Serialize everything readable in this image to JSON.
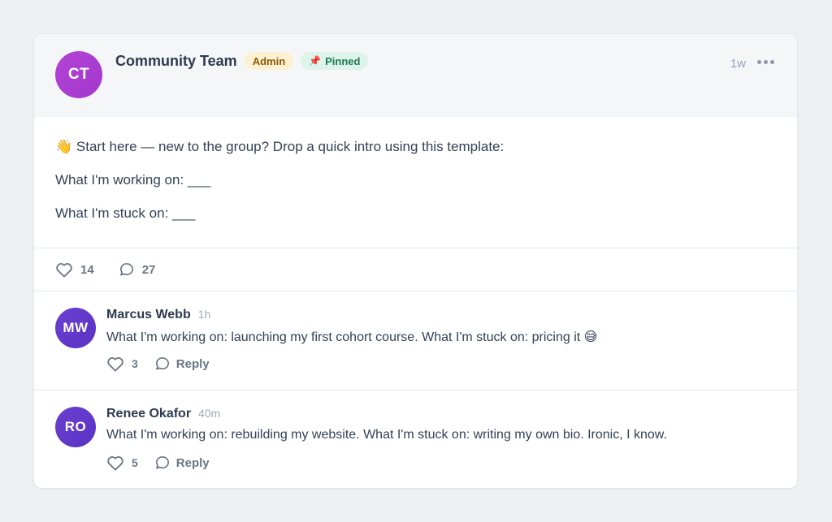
{
  "post": {
    "author": {
      "initials": "CT",
      "name": "Community Team",
      "role_badge": "Admin",
      "pinned_badge": "Pinned",
      "pinned_icon": "📌"
    },
    "time": "1w",
    "more_icon": "more-horizontal-icon",
    "body": {
      "line1": "👋 Start here — new to the group? Drop a quick intro using this template:",
      "line2": "What I'm working on: ___",
      "line3": "What I'm stuck on: ___"
    },
    "likes": "14",
    "comments": "27"
  },
  "comments": [
    {
      "initials": "MW",
      "name": "Marcus Webb",
      "time": "1h",
      "text": "What I'm working on: launching my first cohort course. What I'm stuck on: pricing it 😅",
      "likes": "3",
      "reply_label": "Reply"
    },
    {
      "initials": "RO",
      "name": "Renee Okafor",
      "time": "40m",
      "text": "What I'm working on: rebuilding my website. What I'm stuck on: writing my own bio. Ironic, I know.",
      "likes": "5",
      "reply_label": "Reply"
    }
  ],
  "colors": {
    "author_avatar": "#a93ad0",
    "commenter_avatar": "#6238ca",
    "admin_badge_bg": "#fdf1d2",
    "pinned_badge_bg": "#def3ea"
  }
}
